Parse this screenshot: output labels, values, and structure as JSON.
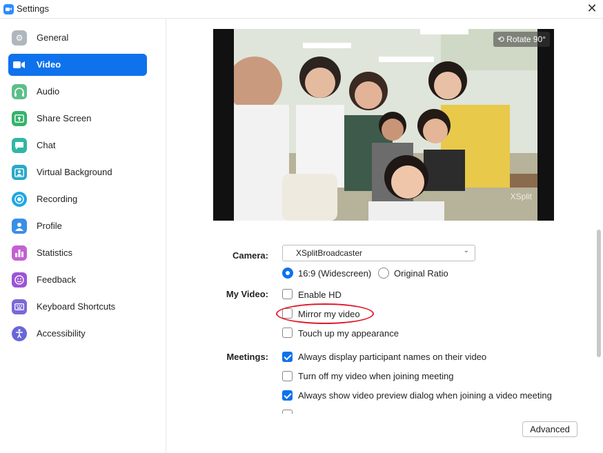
{
  "window": {
    "title": "Settings"
  },
  "sidebar": {
    "items": [
      {
        "label": "General",
        "icon": "gear-icon",
        "color": "#b0b6bd"
      },
      {
        "label": "Video",
        "icon": "camera-icon",
        "color": "#0e72ed"
      },
      {
        "label": "Audio",
        "icon": "headphones-icon",
        "color": "#5cbf8a"
      },
      {
        "label": "Share Screen",
        "icon": "share-screen-icon",
        "color": "#35b36b"
      },
      {
        "label": "Chat",
        "icon": "chat-icon",
        "color": "#30b7a5"
      },
      {
        "label": "Virtual Background",
        "icon": "person-frame-icon",
        "color": "#2aa8c8"
      },
      {
        "label": "Recording",
        "icon": "record-icon",
        "color": "#1ea7e4"
      },
      {
        "label": "Profile",
        "icon": "person-icon",
        "color": "#3a8ee6"
      },
      {
        "label": "Statistics",
        "icon": "bar-chart-icon",
        "color": "#c361d0"
      },
      {
        "label": "Feedback",
        "icon": "smile-icon",
        "color": "#9b55d6"
      },
      {
        "label": "Keyboard Shortcuts",
        "icon": "keyboard-icon",
        "color": "#7b68d8"
      },
      {
        "label": "Accessibility",
        "icon": "accessibility-icon",
        "color": "#6a66d9"
      }
    ]
  },
  "preview": {
    "rotate_label": "Rotate 90°",
    "watermark": "XSplit"
  },
  "camera": {
    "label": "Camera:",
    "selected": "XSplitBroadcaster",
    "ratio_options": [
      {
        "label": "16:9 (Widescreen)",
        "checked": true
      },
      {
        "label": "Original Ratio",
        "checked": false
      }
    ]
  },
  "my_video": {
    "label": "My Video:",
    "options": [
      {
        "label": "Enable HD",
        "checked": false
      },
      {
        "label": "Mirror my video",
        "checked": false
      },
      {
        "label": "Touch up my appearance",
        "checked": false
      }
    ]
  },
  "meetings": {
    "label": "Meetings:",
    "options": [
      {
        "label": "Always display participant names on their video",
        "checked": true
      },
      {
        "label": "Turn off my video when joining meeting",
        "checked": false
      },
      {
        "label": "Always show video preview dialog when joining a video meeting",
        "checked": true
      }
    ]
  },
  "advanced_label": "Advanced",
  "accent_color": "#0e72ed",
  "annotation_color": "#e0192b"
}
